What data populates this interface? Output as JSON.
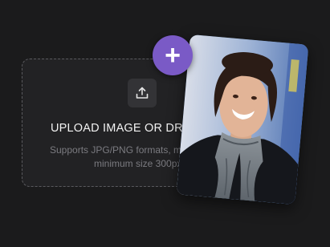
{
  "upload": {
    "title": "UPLOAD IMAGE OR DRAG",
    "subtitle_line1": "Supports JPG/PNG formats, max",
    "subtitle_line2": "minimum size 300px"
  },
  "badge": {
    "symbol": "+"
  },
  "icons": {
    "upload": "upload-tray-icon",
    "add": "plus-icon"
  },
  "colors": {
    "background": "#1b1b1c",
    "accent": "#7a5ac6"
  }
}
